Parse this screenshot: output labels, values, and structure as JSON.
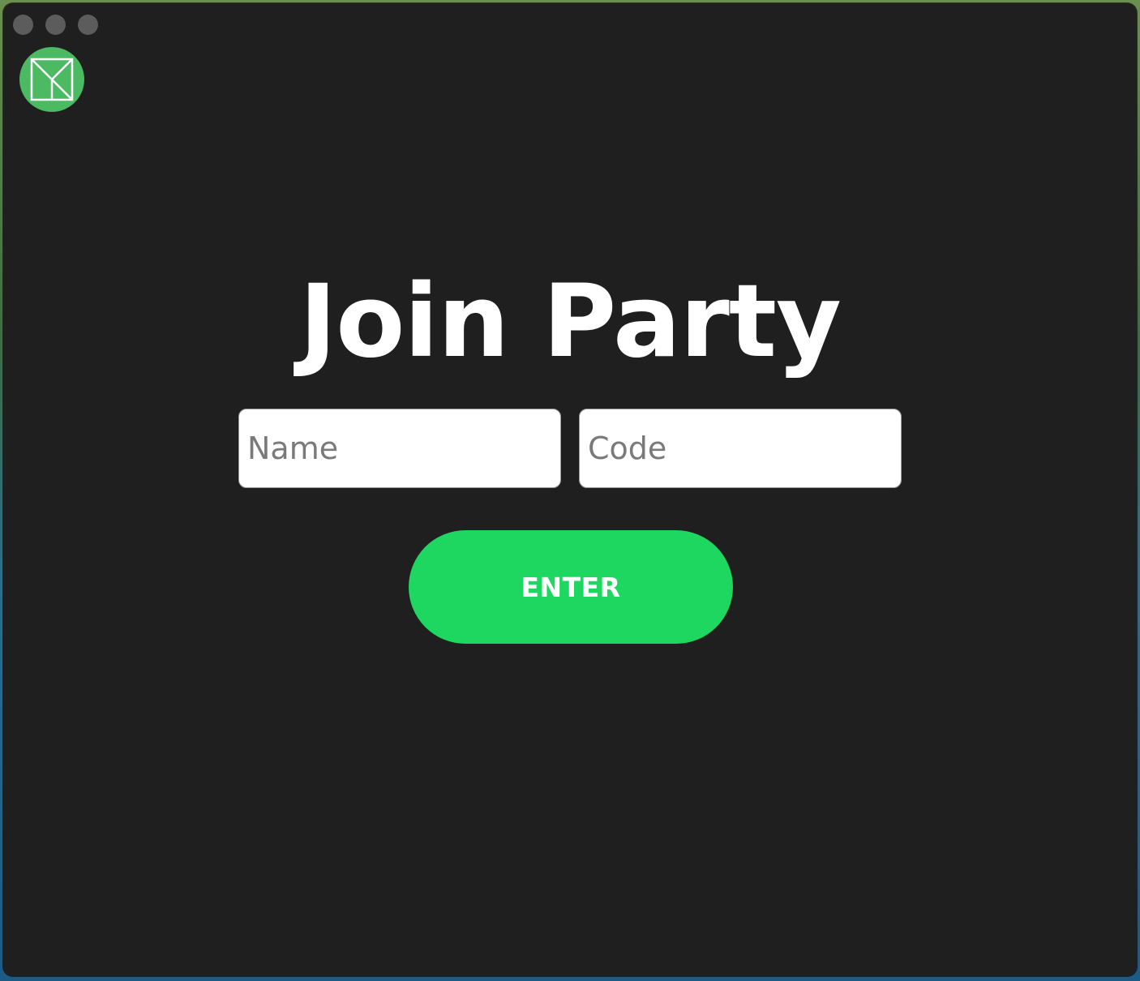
{
  "window": {
    "traffic_lights": [
      "close",
      "minimize",
      "zoom"
    ],
    "background_color": "#1f1f1f"
  },
  "logo": {
    "icon": "app-logo-icon",
    "circle_color": "#4cb963",
    "mark_color": "#ffffff"
  },
  "join": {
    "title": "Join Party",
    "name_placeholder": "Name",
    "name_value": "",
    "code_placeholder": "Code",
    "code_value": "",
    "enter_label": "ENTER",
    "accent_color": "#1ed760"
  }
}
